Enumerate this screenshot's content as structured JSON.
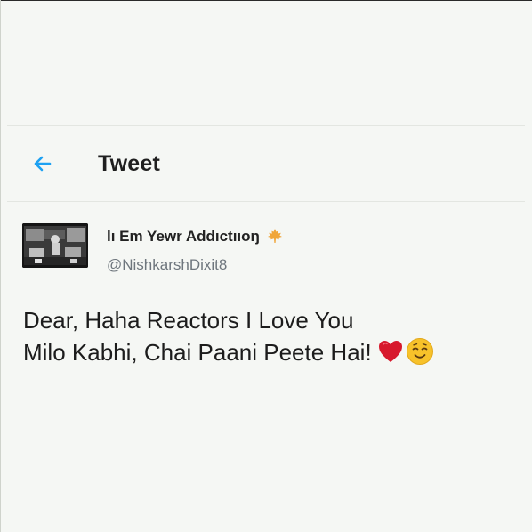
{
  "header": {
    "title": "Tweet",
    "back_icon": "arrow-left-icon"
  },
  "tweet": {
    "author": {
      "name": "lı Em Yewr Addıctııoŋ",
      "handle": "@NishkarshDixit8",
      "badge_icon": "maple-leaf-icon"
    },
    "lines": [
      "Dear, Haha Reactors I Love You",
      "Milo Kabhi, Chai Paani Peete Hai!"
    ],
    "emojis": [
      "red-heart-icon",
      "relieved-face-icon"
    ]
  },
  "colors": {
    "accent": "#1da1f2",
    "background": "#f5f7f4",
    "handle": "#6e767d",
    "heart": "#d7192d",
    "emoji_face": "#f7c22a"
  }
}
